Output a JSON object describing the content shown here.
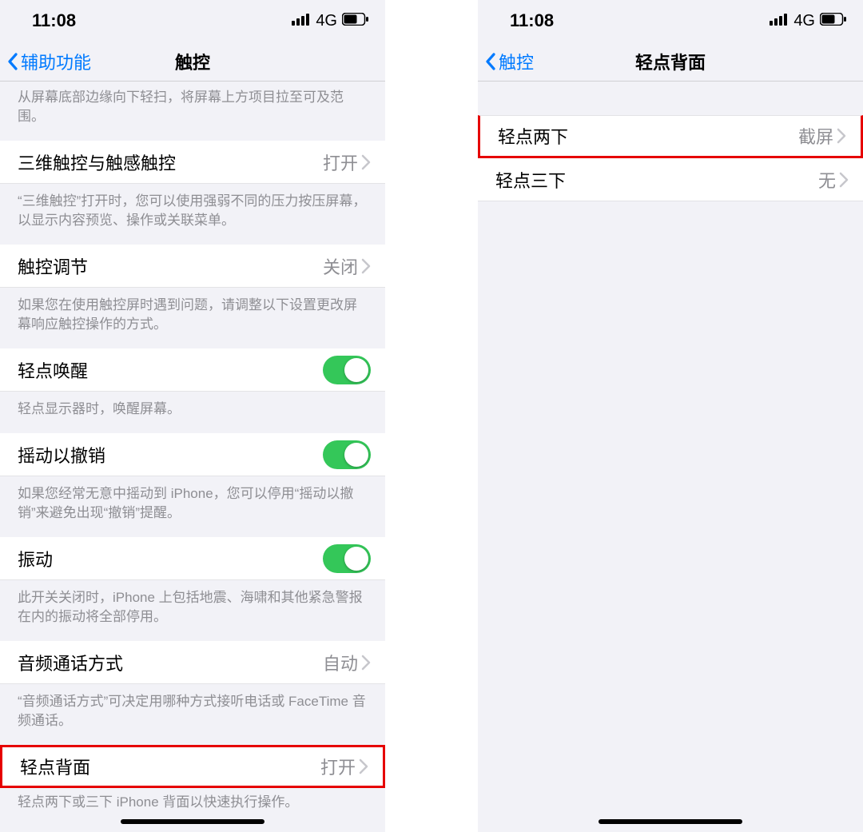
{
  "status": {
    "time": "11:08",
    "network": "4G"
  },
  "left": {
    "back": "辅助功能",
    "title": "触控",
    "top_footer": "从屏幕底部边缘向下轻扫，将屏幕上方项目拉至可及范围。",
    "threeDTouch": {
      "label": "三维触控与触感触控",
      "value": "打开"
    },
    "threeDTouch_footer": "“三维触控”打开时，您可以使用强弱不同的压力按压屏幕，以显示内容预览、操作或关联菜单。",
    "touchAdjust": {
      "label": "触控调节",
      "value": "关闭"
    },
    "touchAdjust_footer": "如果您在使用触控屏时遇到问题，请调整以下设置更改屏幕响应触控操作的方式。",
    "tapToWake": {
      "label": "轻点唤醒"
    },
    "tapToWake_footer": "轻点显示器时，唤醒屏幕。",
    "shakeUndo": {
      "label": "摇动以撤销"
    },
    "shakeUndo_footer": "如果您经常无意中摇动到 iPhone，您可以停用“摇动以撤销”来避免出现“撤销”提醒。",
    "vibration": {
      "label": "振动"
    },
    "vibration_footer": "此开关关闭时，iPhone 上包括地震、海啸和其他紧急警报在内的振动将全部停用。",
    "audioCall": {
      "label": "音频通话方式",
      "value": "自动"
    },
    "audioCall_footer": "“音频通话方式”可决定用哪种方式接听电话或 FaceTime 音频通话。",
    "backTap": {
      "label": "轻点背面",
      "value": "打开"
    },
    "backTap_footer": "轻点两下或三下 iPhone 背面以快速执行操作。"
  },
  "right": {
    "back": "触控",
    "title": "轻点背面",
    "doubleTap": {
      "label": "轻点两下",
      "value": "截屏"
    },
    "tripleTap": {
      "label": "轻点三下",
      "value": "无"
    }
  }
}
